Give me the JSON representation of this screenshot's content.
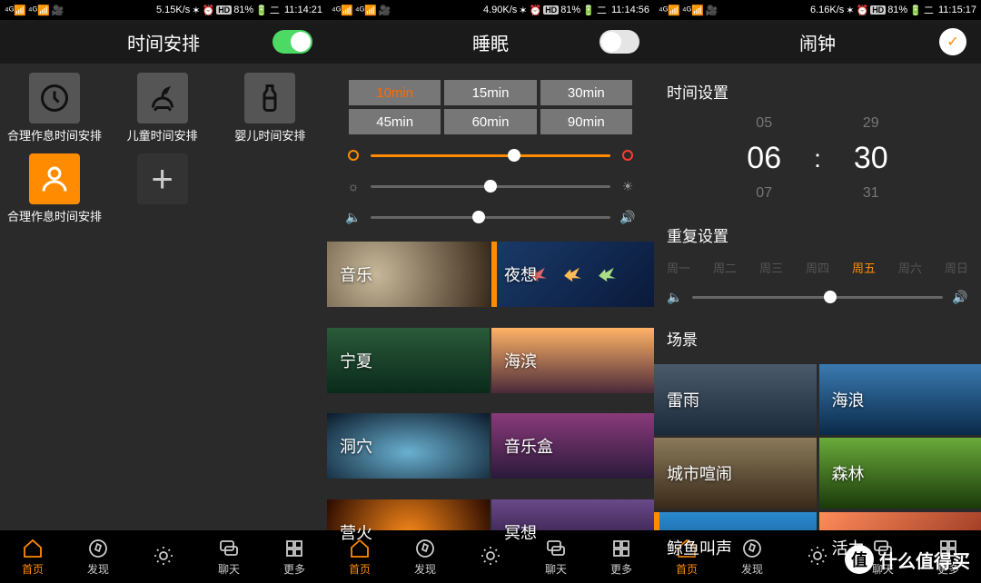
{
  "panels": [
    {
      "status": {
        "speed": "5.15K/s",
        "battery": "81%",
        "time": "11:14:21",
        "day": "二"
      },
      "title": "时间安排",
      "items": [
        {
          "label": "合理作息时间安排",
          "icon": "clock"
        },
        {
          "label": "儿童时间安排",
          "icon": "horse"
        },
        {
          "label": "婴儿时间安排",
          "icon": "bottle"
        },
        {
          "label": "合理作息时间安排",
          "icon": "person",
          "orange": true
        },
        {
          "label": "",
          "icon": "plus"
        }
      ]
    },
    {
      "status": {
        "speed": "4.90K/s",
        "battery": "81%",
        "time": "11:14:56",
        "day": "二"
      },
      "title": "睡眠",
      "durations": [
        "10min",
        "15min",
        "30min",
        "45min",
        "60min",
        "90min"
      ],
      "duration_active": 0,
      "slider_color": 60,
      "slider_bright": 50,
      "slider_vol": 45,
      "sounds": [
        {
          "label": "音乐",
          "bg": "bg-music"
        },
        {
          "label": "夜想",
          "bg": "bg-night",
          "sel": true,
          "origami": true
        },
        {
          "label": "宁夏",
          "bg": "bg-forest"
        },
        {
          "label": "海滨",
          "bg": "bg-beach"
        },
        {
          "label": "洞穴",
          "bg": "bg-cave"
        },
        {
          "label": "音乐盒",
          "bg": "bg-box"
        },
        {
          "label": "营火",
          "bg": "bg-fire"
        },
        {
          "label": "冥想",
          "bg": "bg-dream"
        }
      ]
    },
    {
      "status": {
        "speed": "6.16K/s",
        "battery": "81%",
        "time": "11:15:17",
        "day": "二"
      },
      "title": "闹钟",
      "section_time": "时间设置",
      "picker": {
        "h_prev": "05",
        "h": "06",
        "h_next": "07",
        "m_prev": "29",
        "m": "30",
        "m_next": "31"
      },
      "section_repeat": "重复设置",
      "days": [
        "周一",
        "周二",
        "周三",
        "周四",
        "周五",
        "周六",
        "周日"
      ],
      "day_on": 4,
      "slider_vol": 55,
      "section_scene": "场景",
      "scenes": [
        {
          "label": "雷雨",
          "bg": "bg-storm"
        },
        {
          "label": "海浪",
          "bg": "bg-wave"
        },
        {
          "label": "城市喧闹",
          "bg": "bg-city"
        },
        {
          "label": "森林",
          "bg": "bg-forest2"
        },
        {
          "label": "鲸鱼叫声",
          "bg": "bg-whale",
          "sel": true
        },
        {
          "label": "活力",
          "bg": "bg-energy"
        }
      ]
    }
  ],
  "nav": [
    {
      "label": "首页",
      "icon": "home"
    },
    {
      "label": "发现",
      "icon": "compass"
    },
    {
      "label": "",
      "icon": "sun"
    },
    {
      "label": "聊天",
      "icon": "chat"
    },
    {
      "label": "更多",
      "icon": "grid"
    }
  ],
  "watermark": {
    "badge": "值",
    "text": "什么值得买"
  }
}
